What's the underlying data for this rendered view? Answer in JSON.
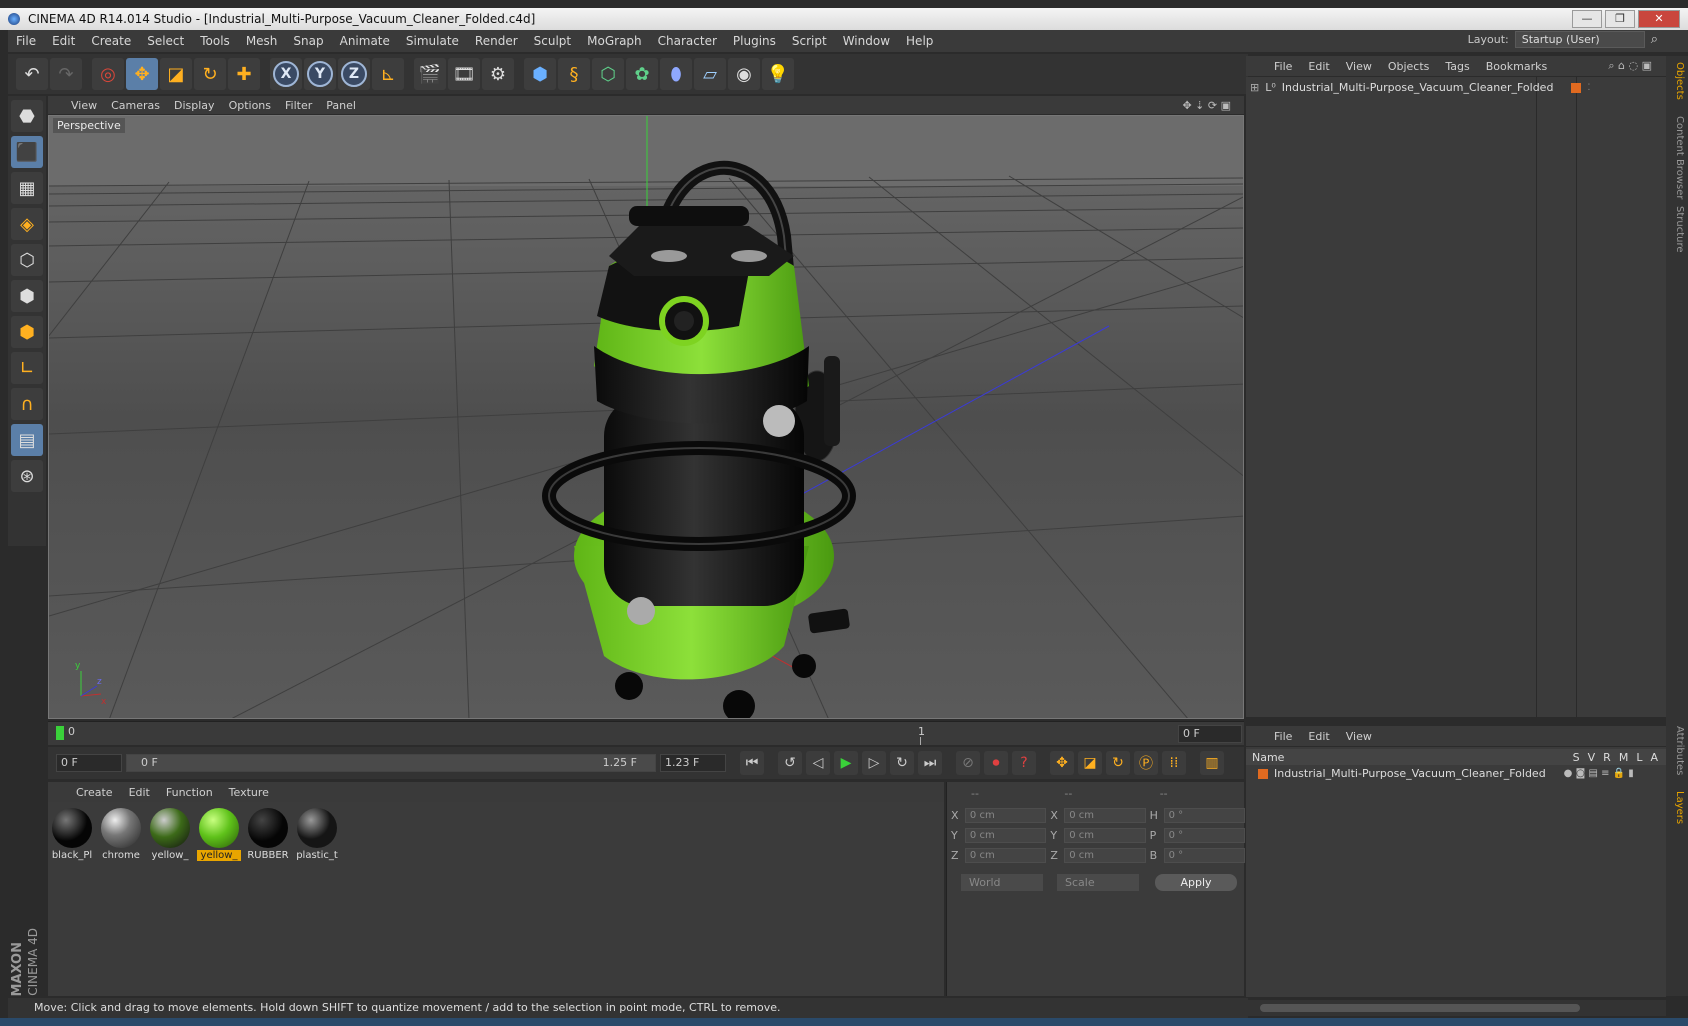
{
  "window": {
    "title": "CINEMA 4D R14.014 Studio - [Industrial_Multi-Purpose_Vacuum_Cleaner_Folded.c4d]",
    "min": "—",
    "restore": "❐",
    "close": "✕"
  },
  "menu": [
    "File",
    "Edit",
    "Create",
    "Select",
    "Tools",
    "Mesh",
    "Snap",
    "Animate",
    "Simulate",
    "Render",
    "Sculpt",
    "MoGraph",
    "Character",
    "Plugins",
    "Script",
    "Window",
    "Help"
  ],
  "layout": {
    "label": "Layout:",
    "value": "Startup (User)"
  },
  "axes": [
    "X",
    "Y",
    "Z"
  ],
  "viewport": {
    "menu": [
      "View",
      "Cameras",
      "Display",
      "Options",
      "Filter",
      "Panel"
    ],
    "label": "Perspective"
  },
  "timeline": {
    "start": "0",
    "marker": "1",
    "frame_field": "0 F"
  },
  "transport": {
    "current": "0 F",
    "range_start": "0 F",
    "range_end": "1.25 F",
    "end": "1.23 F"
  },
  "materials": {
    "menu": [
      "Create",
      "Edit",
      "Function",
      "Texture"
    ],
    "items": [
      {
        "label": "black_Pl",
        "color": "#050505",
        "selected": false
      },
      {
        "label": "chrome",
        "color": "#8a8a8a",
        "selected": false
      },
      {
        "label": "yellow_",
        "color": "#3c6a18",
        "selected": false
      },
      {
        "label": "yellow_",
        "color": "#5fc21a",
        "selected": true
      },
      {
        "label": "RUBBER",
        "color": "#101010",
        "selected": false
      },
      {
        "label": "plastic_t",
        "color": "#1e1e1e",
        "selected": false
      }
    ]
  },
  "coords": {
    "headers": [
      "--",
      "--",
      "--"
    ],
    "rows": [
      {
        "a": "X",
        "av": "0 cm",
        "b": "X",
        "bv": "0 cm",
        "c": "H",
        "cv": "0 °"
      },
      {
        "a": "Y",
        "av": "0 cm",
        "b": "Y",
        "bv": "0 cm",
        "c": "P",
        "cv": "0 °"
      },
      {
        "a": "Z",
        "av": "0 cm",
        "b": "Z",
        "bv": "0 cm",
        "c": "B",
        "cv": "0 °"
      }
    ],
    "mode1": "World",
    "mode2": "Scale",
    "apply": "Apply"
  },
  "objects": {
    "menu": [
      "File",
      "Edit",
      "View",
      "Objects",
      "Tags",
      "Bookmarks"
    ],
    "item": "Industrial_Multi-Purpose_Vacuum_Cleaner_Folded"
  },
  "layers": {
    "menu": [
      "File",
      "Edit",
      "View"
    ],
    "head_name": "Name",
    "head_cols": [
      "S",
      "V",
      "R",
      "M",
      "L",
      "A"
    ],
    "item": "Industrial_Multi-Purpose_Vacuum_Cleaner_Folded"
  },
  "side_tabs": [
    "Objects",
    "Content Browser",
    "Structure",
    "Attributes",
    "Layers"
  ],
  "brand": {
    "top": "MAXON",
    "bottom": "CINEMA 4D"
  },
  "status": "Move: Click and drag to move elements. Hold down SHIFT to quantize movement / add to the selection in point mode, CTRL to remove.",
  "colors": {
    "accent": "#5b7fa8",
    "product_green": "#7ed321",
    "selection": "#e8a500"
  }
}
